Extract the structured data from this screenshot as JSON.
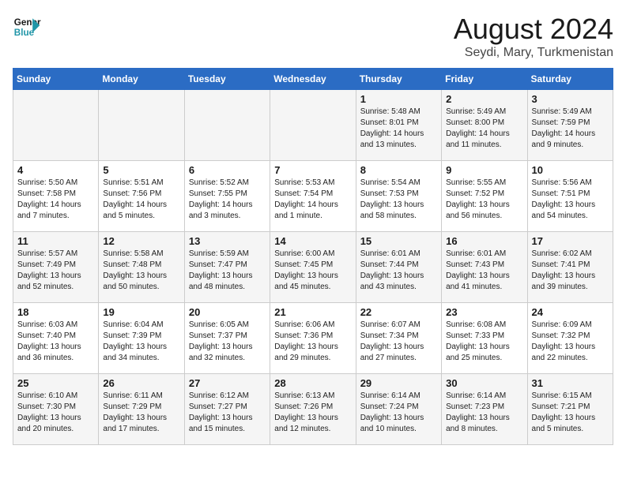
{
  "logo": {
    "line1": "General",
    "line2": "Blue"
  },
  "title": {
    "month_year": "August 2024",
    "location": "Seydi, Mary, Turkmenistan"
  },
  "weekdays": [
    "Sunday",
    "Monday",
    "Tuesday",
    "Wednesday",
    "Thursday",
    "Friday",
    "Saturday"
  ],
  "weeks": [
    [
      {
        "day": "",
        "info": ""
      },
      {
        "day": "",
        "info": ""
      },
      {
        "day": "",
        "info": ""
      },
      {
        "day": "",
        "info": ""
      },
      {
        "day": "1",
        "info": "Sunrise: 5:48 AM\nSunset: 8:01 PM\nDaylight: 14 hours\nand 13 minutes."
      },
      {
        "day": "2",
        "info": "Sunrise: 5:49 AM\nSunset: 8:00 PM\nDaylight: 14 hours\nand 11 minutes."
      },
      {
        "day": "3",
        "info": "Sunrise: 5:49 AM\nSunset: 7:59 PM\nDaylight: 14 hours\nand 9 minutes."
      }
    ],
    [
      {
        "day": "4",
        "info": "Sunrise: 5:50 AM\nSunset: 7:58 PM\nDaylight: 14 hours\nand 7 minutes."
      },
      {
        "day": "5",
        "info": "Sunrise: 5:51 AM\nSunset: 7:56 PM\nDaylight: 14 hours\nand 5 minutes."
      },
      {
        "day": "6",
        "info": "Sunrise: 5:52 AM\nSunset: 7:55 PM\nDaylight: 14 hours\nand 3 minutes."
      },
      {
        "day": "7",
        "info": "Sunrise: 5:53 AM\nSunset: 7:54 PM\nDaylight: 14 hours\nand 1 minute."
      },
      {
        "day": "8",
        "info": "Sunrise: 5:54 AM\nSunset: 7:53 PM\nDaylight: 13 hours\nand 58 minutes."
      },
      {
        "day": "9",
        "info": "Sunrise: 5:55 AM\nSunset: 7:52 PM\nDaylight: 13 hours\nand 56 minutes."
      },
      {
        "day": "10",
        "info": "Sunrise: 5:56 AM\nSunset: 7:51 PM\nDaylight: 13 hours\nand 54 minutes."
      }
    ],
    [
      {
        "day": "11",
        "info": "Sunrise: 5:57 AM\nSunset: 7:49 PM\nDaylight: 13 hours\nand 52 minutes."
      },
      {
        "day": "12",
        "info": "Sunrise: 5:58 AM\nSunset: 7:48 PM\nDaylight: 13 hours\nand 50 minutes."
      },
      {
        "day": "13",
        "info": "Sunrise: 5:59 AM\nSunset: 7:47 PM\nDaylight: 13 hours\nand 48 minutes."
      },
      {
        "day": "14",
        "info": "Sunrise: 6:00 AM\nSunset: 7:45 PM\nDaylight: 13 hours\nand 45 minutes."
      },
      {
        "day": "15",
        "info": "Sunrise: 6:01 AM\nSunset: 7:44 PM\nDaylight: 13 hours\nand 43 minutes."
      },
      {
        "day": "16",
        "info": "Sunrise: 6:01 AM\nSunset: 7:43 PM\nDaylight: 13 hours\nand 41 minutes."
      },
      {
        "day": "17",
        "info": "Sunrise: 6:02 AM\nSunset: 7:41 PM\nDaylight: 13 hours\nand 39 minutes."
      }
    ],
    [
      {
        "day": "18",
        "info": "Sunrise: 6:03 AM\nSunset: 7:40 PM\nDaylight: 13 hours\nand 36 minutes."
      },
      {
        "day": "19",
        "info": "Sunrise: 6:04 AM\nSunset: 7:39 PM\nDaylight: 13 hours\nand 34 minutes."
      },
      {
        "day": "20",
        "info": "Sunrise: 6:05 AM\nSunset: 7:37 PM\nDaylight: 13 hours\nand 32 minutes."
      },
      {
        "day": "21",
        "info": "Sunrise: 6:06 AM\nSunset: 7:36 PM\nDaylight: 13 hours\nand 29 minutes."
      },
      {
        "day": "22",
        "info": "Sunrise: 6:07 AM\nSunset: 7:34 PM\nDaylight: 13 hours\nand 27 minutes."
      },
      {
        "day": "23",
        "info": "Sunrise: 6:08 AM\nSunset: 7:33 PM\nDaylight: 13 hours\nand 25 minutes."
      },
      {
        "day": "24",
        "info": "Sunrise: 6:09 AM\nSunset: 7:32 PM\nDaylight: 13 hours\nand 22 minutes."
      }
    ],
    [
      {
        "day": "25",
        "info": "Sunrise: 6:10 AM\nSunset: 7:30 PM\nDaylight: 13 hours\nand 20 minutes."
      },
      {
        "day": "26",
        "info": "Sunrise: 6:11 AM\nSunset: 7:29 PM\nDaylight: 13 hours\nand 17 minutes."
      },
      {
        "day": "27",
        "info": "Sunrise: 6:12 AM\nSunset: 7:27 PM\nDaylight: 13 hours\nand 15 minutes."
      },
      {
        "day": "28",
        "info": "Sunrise: 6:13 AM\nSunset: 7:26 PM\nDaylight: 13 hours\nand 12 minutes."
      },
      {
        "day": "29",
        "info": "Sunrise: 6:14 AM\nSunset: 7:24 PM\nDaylight: 13 hours\nand 10 minutes."
      },
      {
        "day": "30",
        "info": "Sunrise: 6:14 AM\nSunset: 7:23 PM\nDaylight: 13 hours\nand 8 minutes."
      },
      {
        "day": "31",
        "info": "Sunrise: 6:15 AM\nSunset: 7:21 PM\nDaylight: 13 hours\nand 5 minutes."
      }
    ]
  ]
}
